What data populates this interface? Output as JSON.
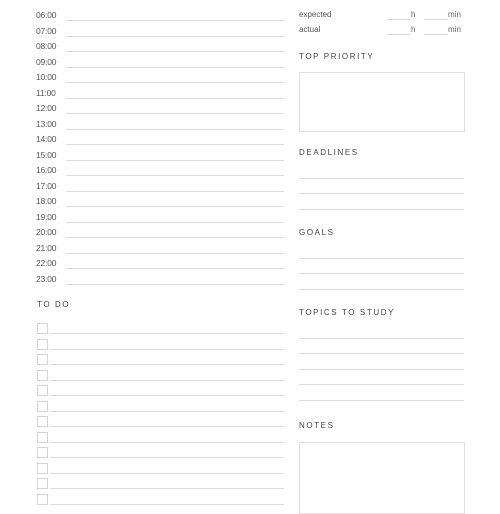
{
  "schedule": {
    "times": [
      "06:00",
      "07:00",
      "08:00",
      "09:00",
      "10:00",
      "11:00",
      "12:00",
      "13:00",
      "14:00",
      "15:00",
      "16:00",
      "17:00",
      "18:00",
      "19:00",
      "20:00",
      "21:00",
      "22:00",
      "23:00"
    ]
  },
  "todo": {
    "title": "TO DO",
    "item_count": 12
  },
  "study_time": {
    "expected_label": "expected",
    "actual_label": "actual",
    "hours_unit": "h",
    "minutes_unit": "min"
  },
  "sections": {
    "top_priority": "TOP PRIORITY",
    "deadlines": "DEADLINES",
    "goals": "GOALS",
    "topics": "TOPICS TO STUDY",
    "notes": "NOTES"
  }
}
